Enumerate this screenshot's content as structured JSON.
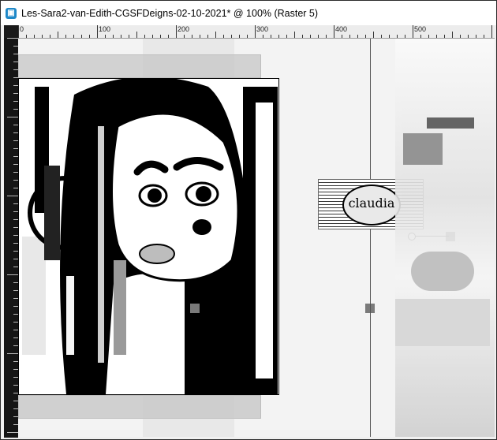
{
  "window": {
    "title": "Les-Sara2-van-Edith-CGSFDeigns-02-10-2021* @ 100% (Raster 5)",
    "app_icon": "psp-app-icon"
  },
  "ruler": {
    "labels": [
      "0",
      "100",
      "200",
      "300",
      "400",
      "500"
    ]
  },
  "canvas": {
    "watermark_text": "claudia",
    "colors": {
      "background": "#f3f3f3",
      "ink": "#000000",
      "skin": "#ffffff"
    }
  }
}
